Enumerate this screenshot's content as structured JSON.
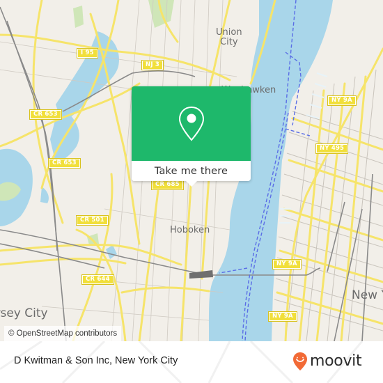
{
  "map": {
    "colors": {
      "land": "#f2efe9",
      "water": "#a9d6ea",
      "park": "#cfe6b8",
      "major_road": "#f6e46a",
      "minor_road": "#c9c4bc",
      "rail": "#8a8a8a",
      "ferry": "#5a6de6"
    },
    "road_shields": [
      {
        "id": "i95",
        "label": "I 95"
      },
      {
        "id": "nj3",
        "label": "NJ 3"
      },
      {
        "id": "cr653a",
        "label": "CR 653"
      },
      {
        "id": "cr653b",
        "label": "CR 653"
      },
      {
        "id": "cr685",
        "label": "CR 685"
      },
      {
        "id": "cr501",
        "label": "CR 501"
      },
      {
        "id": "cr644",
        "label": "CR 644"
      },
      {
        "id": "ny9a-a",
        "label": "NY 9A"
      },
      {
        "id": "ny495",
        "label": "NY 495"
      },
      {
        "id": "ny9a-b",
        "label": "NY 9A"
      },
      {
        "id": "ny9a-c",
        "label": "NY 9A"
      }
    ],
    "places": [
      {
        "id": "union-city",
        "label": "Union\nCity"
      },
      {
        "id": "weehawken",
        "label": "Weehawken"
      },
      {
        "id": "hoboken",
        "label": "Hoboken"
      },
      {
        "id": "jersey-city",
        "label": "Jersey City"
      },
      {
        "id": "new-york",
        "label": "New York"
      }
    ],
    "attribution": "© OpenStreetMap contributors"
  },
  "popup": {
    "icon": "map-pin-icon",
    "accent": "#1eb86b",
    "button_label": "Take me there"
  },
  "footer": {
    "place_name": "D Kwitman & Son Inc, New York City",
    "brand": {
      "name": "moovit",
      "logo_icon": "moovit-smile-pin-icon",
      "logo_color": "#f26a36"
    }
  }
}
